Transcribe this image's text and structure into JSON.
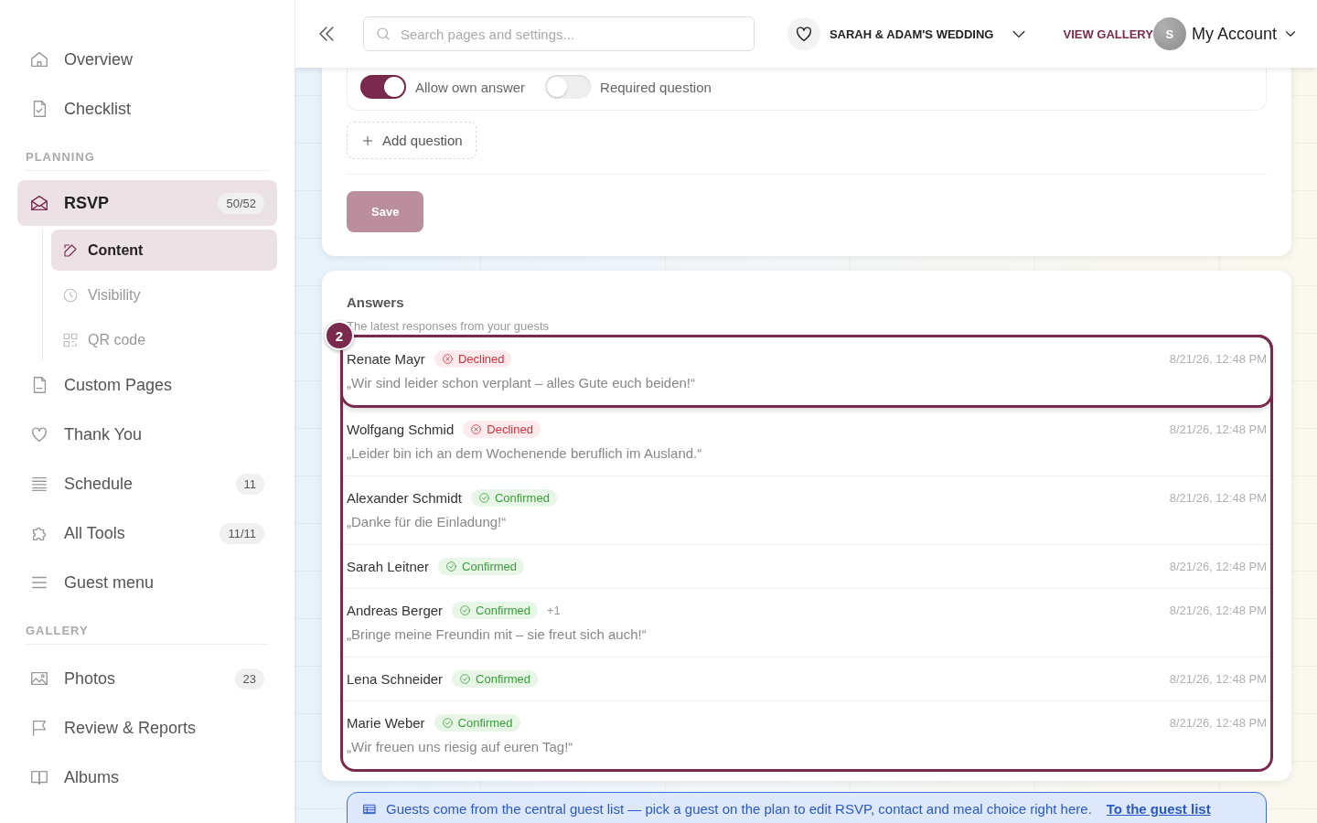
{
  "sidebar": {
    "groups": [
      {
        "items": [
          {
            "label": "Overview",
            "selected": false
          },
          {
            "label": "Checklist",
            "selected": false
          }
        ]
      },
      {
        "heading": "PLANNING",
        "items": [
          {
            "label": "RSVP",
            "badge": "50/52",
            "selected": true,
            "children": [
              {
                "label": "Content",
                "selected": true
              },
              {
                "label": "Visibility",
                "selected": false
              },
              {
                "label": "QR code",
                "selected": false
              }
            ]
          },
          {
            "label": "Custom Pages",
            "selected": false
          },
          {
            "label": "Thank You",
            "selected": false
          },
          {
            "label": "Schedule",
            "badge": "11",
            "selected": false
          },
          {
            "label": "All Tools",
            "badge": "11/11",
            "selected": false
          },
          {
            "label": "Guest menu",
            "selected": false
          }
        ]
      },
      {
        "heading": "GALLERY",
        "items": [
          {
            "label": "Photos",
            "badge": "23",
            "selected": false
          },
          {
            "label": "Review & Reports",
            "selected": false
          },
          {
            "label": "Albums",
            "selected": false
          }
        ]
      }
    ]
  },
  "header": {
    "search": {
      "placeholder": "Search pages and settings..."
    },
    "event": "SARAH & ADAM'S WEDDING",
    "view_gallery": "VIEW GALLERY",
    "account": {
      "initial": "S",
      "label": "My Account"
    }
  },
  "question_card": {
    "toggles": [
      {
        "label": "Allow own answer",
        "on": true
      },
      {
        "label": "Required question",
        "on": false
      }
    ],
    "add_question": "Add question",
    "save": {
      "label": "Save",
      "disabled": true
    }
  },
  "answers": {
    "title": "Answers",
    "subtitle": "The latest responses from your guests",
    "tour_step": "2",
    "rows": [
      {
        "name": "Renate Mayr",
        "kind": "declined",
        "status": "Declined",
        "message": "„Wir sind leider schon verplant – alles Gute euch beiden!“",
        "time": "8/21/26, 12:48 PM",
        "highlighted": true
      },
      {
        "name": "Wolfgang Schmid",
        "kind": "declined",
        "status": "Declined",
        "message": "„Leider bin ich an dem Wochenende beruflich im Ausland.“",
        "time": "8/21/26, 12:48 PM",
        "highlighted": false
      },
      {
        "name": "Alexander Schmidt",
        "kind": "confirmed",
        "status": "Confirmed",
        "message": "„Danke für die Einladung!“",
        "time": "8/21/26, 12:48 PM",
        "highlighted": false
      },
      {
        "name": "Sarah Leitner",
        "kind": "confirmed",
        "status": "Confirmed",
        "time": "8/21/26, 12:48 PM",
        "highlighted": false
      },
      {
        "name": "Andreas Berger",
        "kind": "confirmed",
        "status": "Confirmed",
        "extra": "+1",
        "message": "„Bringe meine Freundin mit – sie freut sich auch!“",
        "time": "8/21/26, 12:48 PM",
        "highlighted": false
      },
      {
        "name": "Lena Schneider",
        "kind": "confirmed",
        "status": "Confirmed",
        "time": "8/21/26, 12:48 PM",
        "highlighted": false
      },
      {
        "name": "Marie Weber",
        "kind": "confirmed",
        "status": "Confirmed",
        "message": "„Wir freuen uns riesig auf euren Tag!“",
        "time": "8/21/26, 12:48 PM",
        "highlighted": false
      }
    ]
  },
  "notice": {
    "text": "Guests come from the central guest list — pick a guest on the plan to edit RSVP, contact and meal choice right here.",
    "link": "To the guest list"
  }
}
